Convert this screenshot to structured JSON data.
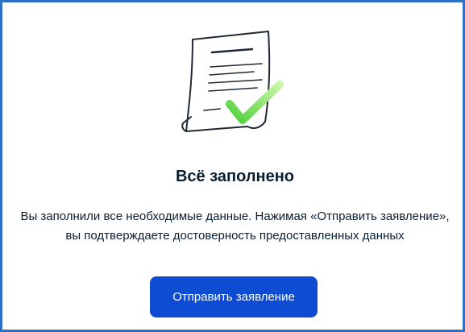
{
  "dialog": {
    "illustration_icon": "document-check-icon",
    "title": "Всё заполнено",
    "description": "Вы заполнили все необходимые данные. Нажимая «Отправить заявление», вы подтверждаете достоверность предоставленных данных",
    "submit_label": "Отправить заявление"
  },
  "colors": {
    "accent": "#0d4cd3",
    "frame": "#2f6fc6",
    "check": "#78e03a",
    "text": "#0b1f33"
  }
}
